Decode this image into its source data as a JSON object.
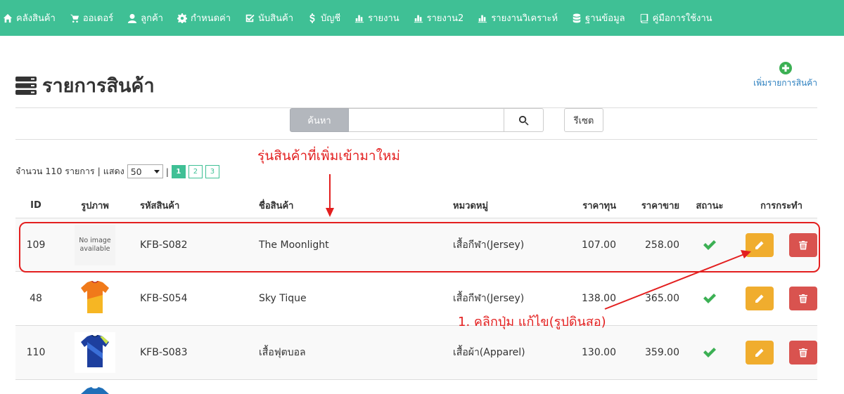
{
  "nav": [
    {
      "icon": "home-icon",
      "label": "คลังสินค้า"
    },
    {
      "icon": "cart-icon",
      "label": "ออเดอร์"
    },
    {
      "icon": "user-icon",
      "label": "ลูกค้า"
    },
    {
      "icon": "gear-icon",
      "label": "กำหนดค่า"
    },
    {
      "icon": "check-square-icon",
      "label": "นับสินค้า"
    },
    {
      "icon": "dollar-icon",
      "label": "บัญชี"
    },
    {
      "icon": "bar-chart-icon",
      "label": "รายงาน"
    },
    {
      "icon": "bar-chart-icon",
      "label": "รายงาน2"
    },
    {
      "icon": "bar-chart-icon",
      "label": "รายงานวิเคราะห์"
    },
    {
      "icon": "database-icon",
      "label": "ฐานข้อมูล"
    },
    {
      "icon": "book-icon",
      "label": "คู่มือการใช้งาน"
    }
  ],
  "page": {
    "title": "รายการสินค้า",
    "add_label": "เพิ่มรายการสินค้า"
  },
  "search": {
    "label": "ค้นหา",
    "value": "",
    "placeholder": "",
    "reset_label": "รีเซต"
  },
  "counter": {
    "total_text": "จำนวน 110 รายการ | แสดง",
    "per_page": "50",
    "separator": "|",
    "pages": [
      "1",
      "2",
      "3"
    ],
    "active_page": "1"
  },
  "annotations": {
    "new_model": "รุ่นสินค้าที่เพิ่มเข้ามาใหม่",
    "click_edit": "1. คลิกปุ่ม แก้ไข(รูปดินสอ)"
  },
  "table": {
    "columns": [
      "ID",
      "รูปภาพ",
      "รหัสสินค้า",
      "ชื่อสินค้า",
      "หมวดหมู่",
      "ราคาทุน",
      "ราคาขาย",
      "สถานะ",
      "การกระทำ"
    ],
    "rows": [
      {
        "id": "109",
        "image": "No image available",
        "code": "KFB-S082",
        "name": "The Moonlight",
        "category": "เสื้อกีฬา(Jersey)",
        "cost": "107.00",
        "price": "258.00",
        "status": "active"
      },
      {
        "id": "48",
        "image": "orange-jersey",
        "code": "KFB-S054",
        "name": "Sky Tique",
        "category": "เสื้อกีฬา(Jersey)",
        "cost": "138.00",
        "price": "365.00",
        "status": "active"
      },
      {
        "id": "110",
        "image": "blue-jersey",
        "code": "KFB-S083",
        "name": "เสื้อฟุตบอล",
        "category": "เสื้อผ้า(Apparel)",
        "cost": "130.00",
        "price": "359.00",
        "status": "active"
      }
    ]
  },
  "colors": {
    "nav_bg": "#3fc095",
    "edit": "#f0ad2e",
    "delete": "#d9534f",
    "annotation": "#e31f1f",
    "link": "#2b7fbf"
  }
}
